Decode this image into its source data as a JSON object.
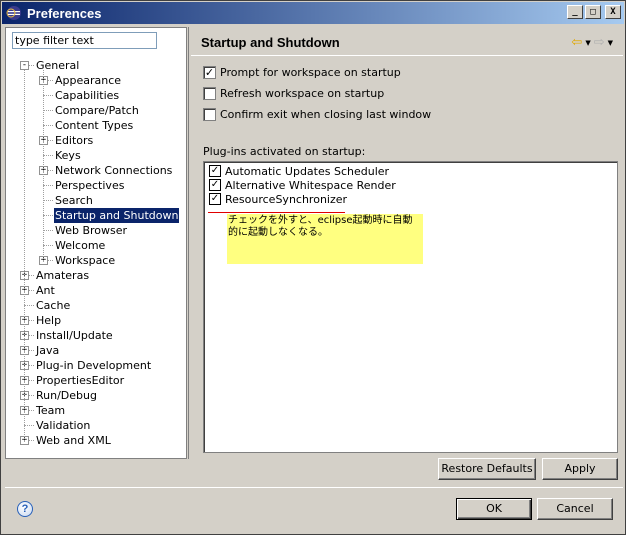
{
  "window": {
    "title": "Preferences"
  },
  "titlebar_buttons": {
    "minimize": "_",
    "maximize": "□",
    "close": "X"
  },
  "filter": {
    "placeholder": "type filter text",
    "value": "type filter text"
  },
  "tree": [
    {
      "label": "General",
      "level": 0,
      "expander": "-"
    },
    {
      "label": "Appearance",
      "level": 1,
      "expander": "+"
    },
    {
      "label": "Capabilities",
      "level": 1,
      "expander": ""
    },
    {
      "label": "Compare/Patch",
      "level": 1,
      "expander": ""
    },
    {
      "label": "Content Types",
      "level": 1,
      "expander": ""
    },
    {
      "label": "Editors",
      "level": 1,
      "expander": "+"
    },
    {
      "label": "Keys",
      "level": 1,
      "expander": ""
    },
    {
      "label": "Network Connections",
      "level": 1,
      "expander": "+"
    },
    {
      "label": "Perspectives",
      "level": 1,
      "expander": ""
    },
    {
      "label": "Search",
      "level": 1,
      "expander": ""
    },
    {
      "label": "Startup and Shutdown",
      "level": 1,
      "expander": "",
      "selected": true
    },
    {
      "label": "Web Browser",
      "level": 1,
      "expander": ""
    },
    {
      "label": "Welcome",
      "level": 1,
      "expander": ""
    },
    {
      "label": "Workspace",
      "level": 1,
      "expander": "+"
    },
    {
      "label": "Amateras",
      "level": 0,
      "expander": "+"
    },
    {
      "label": "Ant",
      "level": 0,
      "expander": "+"
    },
    {
      "label": "Cache",
      "level": 0,
      "expander": ""
    },
    {
      "label": "Help",
      "level": 0,
      "expander": "+"
    },
    {
      "label": "Install/Update",
      "level": 0,
      "expander": "+"
    },
    {
      "label": "Java",
      "level": 0,
      "expander": "+"
    },
    {
      "label": "Plug-in Development",
      "level": 0,
      "expander": "+"
    },
    {
      "label": "PropertiesEditor",
      "level": 0,
      "expander": "+"
    },
    {
      "label": "Run/Debug",
      "level": 0,
      "expander": "+"
    },
    {
      "label": "Team",
      "level": 0,
      "expander": "+"
    },
    {
      "label": "Validation",
      "level": 0,
      "expander": ""
    },
    {
      "label": "Web and XML",
      "level": 0,
      "expander": "+"
    }
  ],
  "page": {
    "title": "Startup and Shutdown",
    "nav_back": "⇦",
    "nav_dropdown": "▼",
    "nav_forward": "⇨",
    "options": [
      {
        "label": "Prompt for workspace on startup",
        "checked": true
      },
      {
        "label": "Refresh workspace on startup",
        "checked": false
      },
      {
        "label": "Confirm exit when closing last window",
        "checked": false
      }
    ],
    "plugins_label": "Plug-ins activated on startup:",
    "plugins": [
      {
        "label": "Automatic Updates Scheduler",
        "checked": true
      },
      {
        "label": "Alternative Whitespace Render",
        "checked": true
      },
      {
        "label": "ResourceSynchronizer",
        "checked": true
      }
    ],
    "annotation": "チェックを外すと、eclipse起動時に自動的に起動しなくなる。",
    "restore_defaults": "Restore Defaults",
    "apply": "Apply"
  },
  "footer": {
    "help": "?",
    "ok": "OK",
    "cancel": "Cancel"
  },
  "colors": {
    "selection": "#0a246a",
    "annotation_bg": "#ffff80",
    "annotation_line": "#e00000"
  }
}
